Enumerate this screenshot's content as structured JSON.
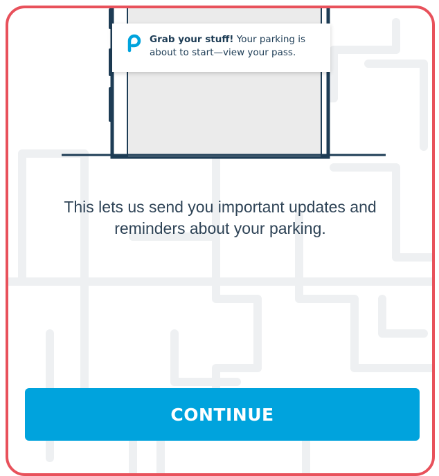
{
  "notification": {
    "icon": "parking-p-icon",
    "title_bold": "Grab your stuff!",
    "title_rest": " Your parking is",
    "line2": "about to start—view your pass."
  },
  "message": {
    "line1": "This lets us send you important updates and",
    "line2": "reminders about your parking."
  },
  "continue_button": {
    "label": "CONTINUE"
  },
  "colors": {
    "accent": "#00a3dd",
    "frame_border": "#e8515b",
    "text": "#2e4356",
    "map_lines": "#eef0f2"
  }
}
